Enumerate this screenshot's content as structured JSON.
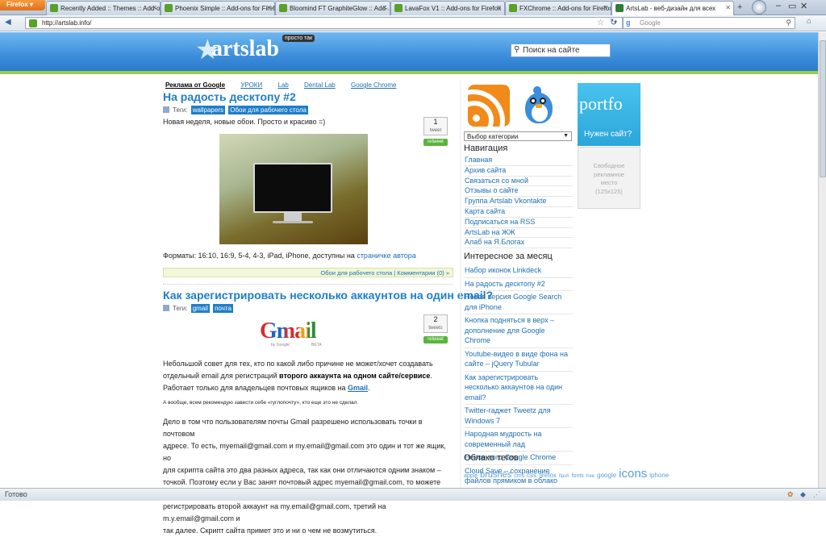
{
  "browser": {
    "firefox_button": "Firefox",
    "tabs": [
      {
        "label": "Recently Added :: Themes :: Add-ons..."
      },
      {
        "label": "Phoenix Simple :: Add-ons for Firefox"
      },
      {
        "label": "Bloomind FT GraphiteGlow :: Add-..."
      },
      {
        "label": "LavaFox V1 :: Add-ons for Firefox"
      },
      {
        "label": "FXChrome :: Add-ons for Firefox"
      },
      {
        "label": "ArtsLab - веб-дизайн для всех"
      }
    ],
    "new_tab_glyph": "+",
    "url": "http://artslab.info/",
    "search_engine_icon": "google-icon",
    "search_placeholder": "Google",
    "window_controls": [
      "–",
      "▭",
      "✕"
    ]
  },
  "site": {
    "logo_text": "artslab",
    "logo_tag": "просто так",
    "search_placeholder": "Поиск на сайте",
    "top_links": [
      {
        "label": "Реклама от Google",
        "current": true
      },
      {
        "label": "УРОКИ",
        "current": false
      },
      {
        "label": "Lab",
        "current": false
      },
      {
        "label": "Dental Lab",
        "current": false
      },
      {
        "label": "Google Chrome",
        "current": false
      }
    ],
    "tags_label": "Теги:"
  },
  "posts": [
    {
      "title": "На радость десктопу #2",
      "tags": [
        "wallpapers",
        "Обои для рабочего стола"
      ],
      "intro": "Новая неделя, новые обои. Просто и красиво =)",
      "tweet_count": "1",
      "tweet_label": "tweet",
      "retweet_label": "retweet",
      "formats_text": "Форматы: 16:10, 16:9, 5-4, 4-3, iPad, iPhone, доступны на ",
      "formats_link": "страничке автора",
      "meta_category": "Обои для рабочего стола",
      "meta_sep": " | ",
      "meta_comments": "Комментарии (0) »"
    },
    {
      "title": "Как зарегистрировать несколько аккаунтов на один email?",
      "tags": [
        "gmail",
        "почта"
      ],
      "tweet_count": "2",
      "tweet_label": "tweets",
      "retweet_label": "retweet",
      "gmail_logo": "Gmail",
      "gmail_by": "by Google",
      "gmail_beta": "BETA",
      "p1_a": "Небольшой совет для тех, кто по какой либо причине не может/хочет создавать",
      "p1_b": "отдельный email для регистраций ",
      "p1_bold": "второго аккаунта на одном сайте/сервисе",
      "p1_c": "Работает только для владельцев почтовых ящиков на ",
      "p1_link": "Gmail",
      "small_note": "А вообще, всем рекомендую завести себе «гуглопочту», кто еще это не сделал.",
      "p2_lines": [
        "Дело в том что пользователям почты Gmail разрешено использовать точки в почтовом",
        "адресе. То есть, myemail@gmail.com и my.email@gmail.com это один и тот же ящик, но",
        "для скрипта сайта это два разных адреса, так как они отличаются одним знаком –",
        "точкой. Поэтому если у Вас занят почтовый адрес myemail@gmail.com, то можете смело",
        "регистрировать второй аккаунт на my.email@gmail.com, третий на m.y.email@gmail.com и",
        "так далее. Скрипт сайта примет это и ни о чем не возмутиться."
      ]
    }
  ],
  "sidebar": {
    "category_select": "Выбор категории",
    "nav_title": "Навигация",
    "nav_items": [
      "Главная",
      "Архив сайта",
      "Связаться со мной",
      "Отзывы о сайте",
      "Группа Artslab Vkontakte",
      "Карта сайта",
      "Подписаться на RSS",
      "ArtsLab на ЖЖ",
      "Алаб на Я.Блогах"
    ],
    "interesting_title": "Интересное за месяц",
    "interesting_items": [
      "Набор иконок Linkdeck",
      "На радость десктопу #2",
      "Новая версия Google Search для iPhone",
      "Кнопка подняться в верх – дополнение для Google Chrome",
      "Youtube-видео в виде фона на сайте – jQuery Tubular",
      "Как зарегистрировать несколько аккаунтов на один email?",
      "Twitter-гаджет Tweetz для Windows 7",
      "Народная мудрость на современный лад",
      "Новое лого Google Chrome",
      "Cloud Save – сохранение файлов прямиком в облако"
    ],
    "cloud_title": "Облако тегов",
    "cloud_tags": [
      {
        "t": "apple",
        "s": 7
      },
      {
        "t": "brushes",
        "s": 11
      },
      {
        "t": "cms",
        "s": 7
      },
      {
        "t": "css",
        "s": 8
      },
      {
        "t": "firefox",
        "s": 8
      },
      {
        "t": "flash",
        "s": 6
      },
      {
        "t": "fonts",
        "s": 7
      },
      {
        "t": "free",
        "s": 6
      },
      {
        "t": "google",
        "s": 8
      },
      {
        "t": "icons",
        "s": 15
      },
      {
        "t": "iphone",
        "s": 8
      }
    ]
  },
  "ads": {
    "portfolio_text": "portfo",
    "portfolio_caption": "Нужен сайт?",
    "free_place_lines": [
      "Свободное",
      "рекламное",
      "место",
      "(125x125)"
    ]
  },
  "status": {
    "text": "Готово"
  }
}
